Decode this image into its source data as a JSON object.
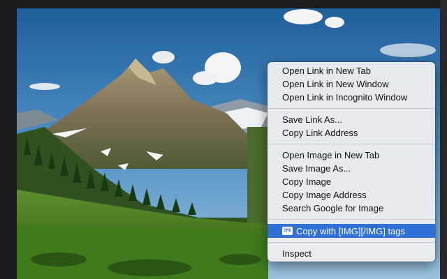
{
  "background": {
    "description_icon": "mountain-landscape-photo"
  },
  "context_menu": {
    "groups": [
      {
        "items": [
          {
            "label": "Open Link in New Tab"
          },
          {
            "label": "Open Link in New Window"
          },
          {
            "label": "Open Link in Incognito Window"
          }
        ]
      },
      {
        "items": [
          {
            "label": "Save Link As..."
          },
          {
            "label": "Copy Link Address"
          }
        ]
      },
      {
        "items": [
          {
            "label": "Open Image in New Tab"
          },
          {
            "label": "Save Image As..."
          },
          {
            "label": "Copy Image"
          },
          {
            "label": "Copy Image Address"
          },
          {
            "label": "Search Google for Image"
          }
        ]
      },
      {
        "items": [
          {
            "label": "Copy with [IMG][/IMG] tags",
            "icon_text": "IMG",
            "highlighted": true
          }
        ]
      },
      {
        "items": [
          {
            "label": "Inspect"
          }
        ]
      }
    ]
  },
  "colors": {
    "highlight": "#2f6fd6",
    "menu_bg": "#ececee"
  }
}
